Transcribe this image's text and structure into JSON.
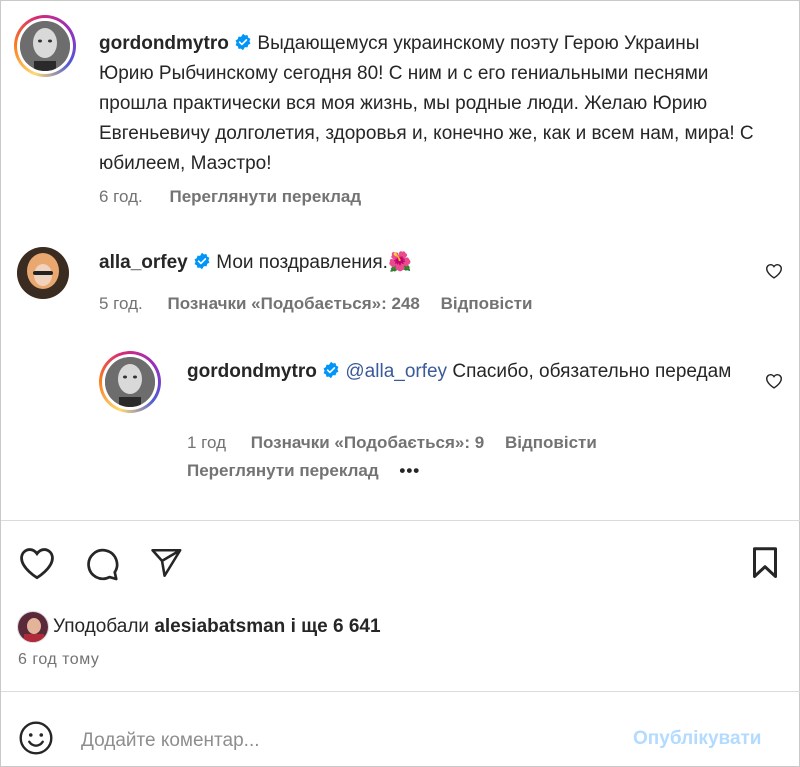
{
  "post": {
    "author": "gordondmytro",
    "caption": "Выдающемуся украинскому поэту Герою Украины Юрию Рыбчинскому сегодня 80! С ним и с его гениальными песнями прошла практически вся моя жизнь, мы родные люди. Желаю Юрию Евгеньевичу долголетия, здоровья и, конечно же, как и всем нам, мира! С юбилеем, Маэстро!",
    "time": "6 год.",
    "translate": "Переглянути переклад"
  },
  "comments": [
    {
      "author": "alla_orfey",
      "text": "Мои поздравления.",
      "emoji": "🌺",
      "time": "5 год.",
      "likes": "Позначки «Подобається»: 248",
      "reply": "Відповісти"
    }
  ],
  "reply": {
    "author": "gordondmytro",
    "mention": "@alla_orfey",
    "text": "Спасибо, обязательно передам",
    "time": "1 год",
    "likes": "Позначки «Подобається»: 9",
    "reply": "Відповісти",
    "translate": "Переглянути переклад",
    "more": "•••"
  },
  "likes_summary": {
    "prefix": "Уподобали",
    "user": "alesiabatsman",
    "suffix": "і ще 6 641"
  },
  "posted_ago": "6 год тому",
  "comment_box": {
    "placeholder": "Додайте коментар...",
    "post_label": "Опублікувати"
  },
  "colors": {
    "verified": "#0095f6",
    "muted": "#737373",
    "post_button_disabled": "#b3dbff"
  },
  "icons": {
    "like": "heart-icon",
    "comment": "comment-bubble-icon",
    "share": "paper-plane-icon",
    "save": "bookmark-icon",
    "emoji": "emoji-smiley-icon",
    "verified": "verified-badge-icon"
  }
}
